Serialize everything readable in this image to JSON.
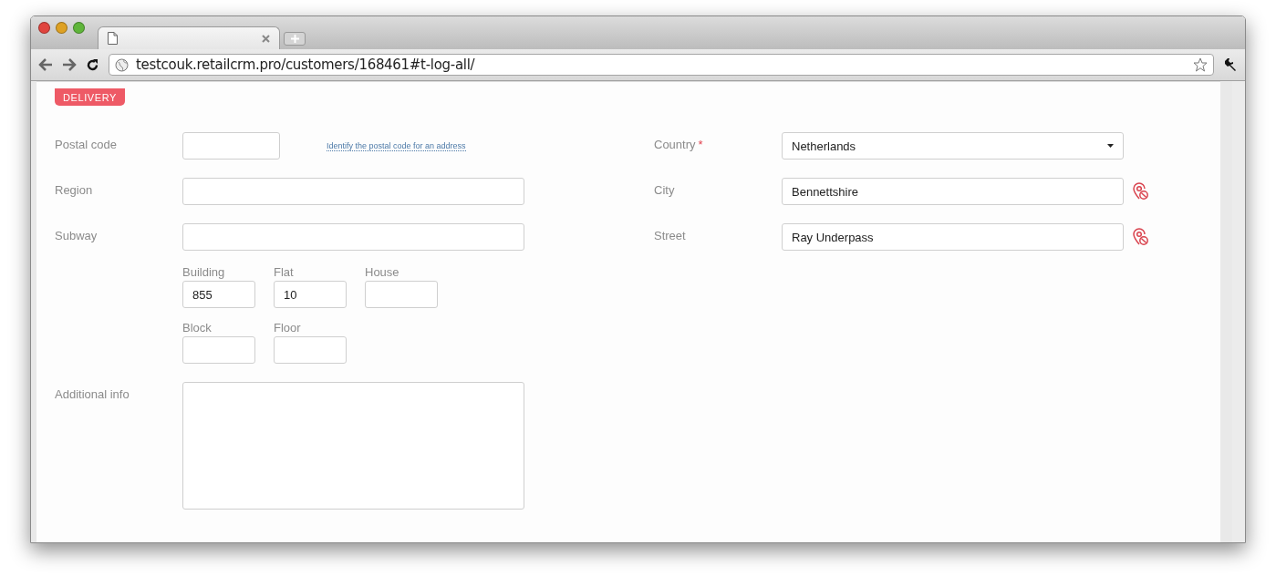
{
  "browser": {
    "url": "testcouk.retailcrm.pro/customers/168461#t-log-all/"
  },
  "section": {
    "badge": "DELIVERY"
  },
  "left_fields": [
    {
      "kind": "postal",
      "label": "Postal code",
      "hint_link": "Identify the postal code for an address"
    },
    {
      "kind": "text",
      "label": "Region"
    },
    {
      "kind": "text",
      "label": "Subway"
    },
    {
      "kind": "parts",
      "rows": [
        [
          {
            "label": "Building",
            "value": "855"
          },
          {
            "label": "Flat",
            "value": "10"
          },
          {
            "label": "House"
          }
        ],
        [
          {
            "label": "Block"
          },
          {
            "label": "Floor"
          }
        ]
      ]
    },
    {
      "kind": "textarea",
      "label": "Additional info"
    }
  ],
  "right_fields": [
    {
      "kind": "select",
      "label": "Country",
      "required_mark": "*",
      "value": "Netherlands"
    },
    {
      "kind": "locate",
      "label": "City",
      "value": "Bennettshire"
    },
    {
      "kind": "locate",
      "label": "Street",
      "value": "Ray Underpass"
    }
  ]
}
